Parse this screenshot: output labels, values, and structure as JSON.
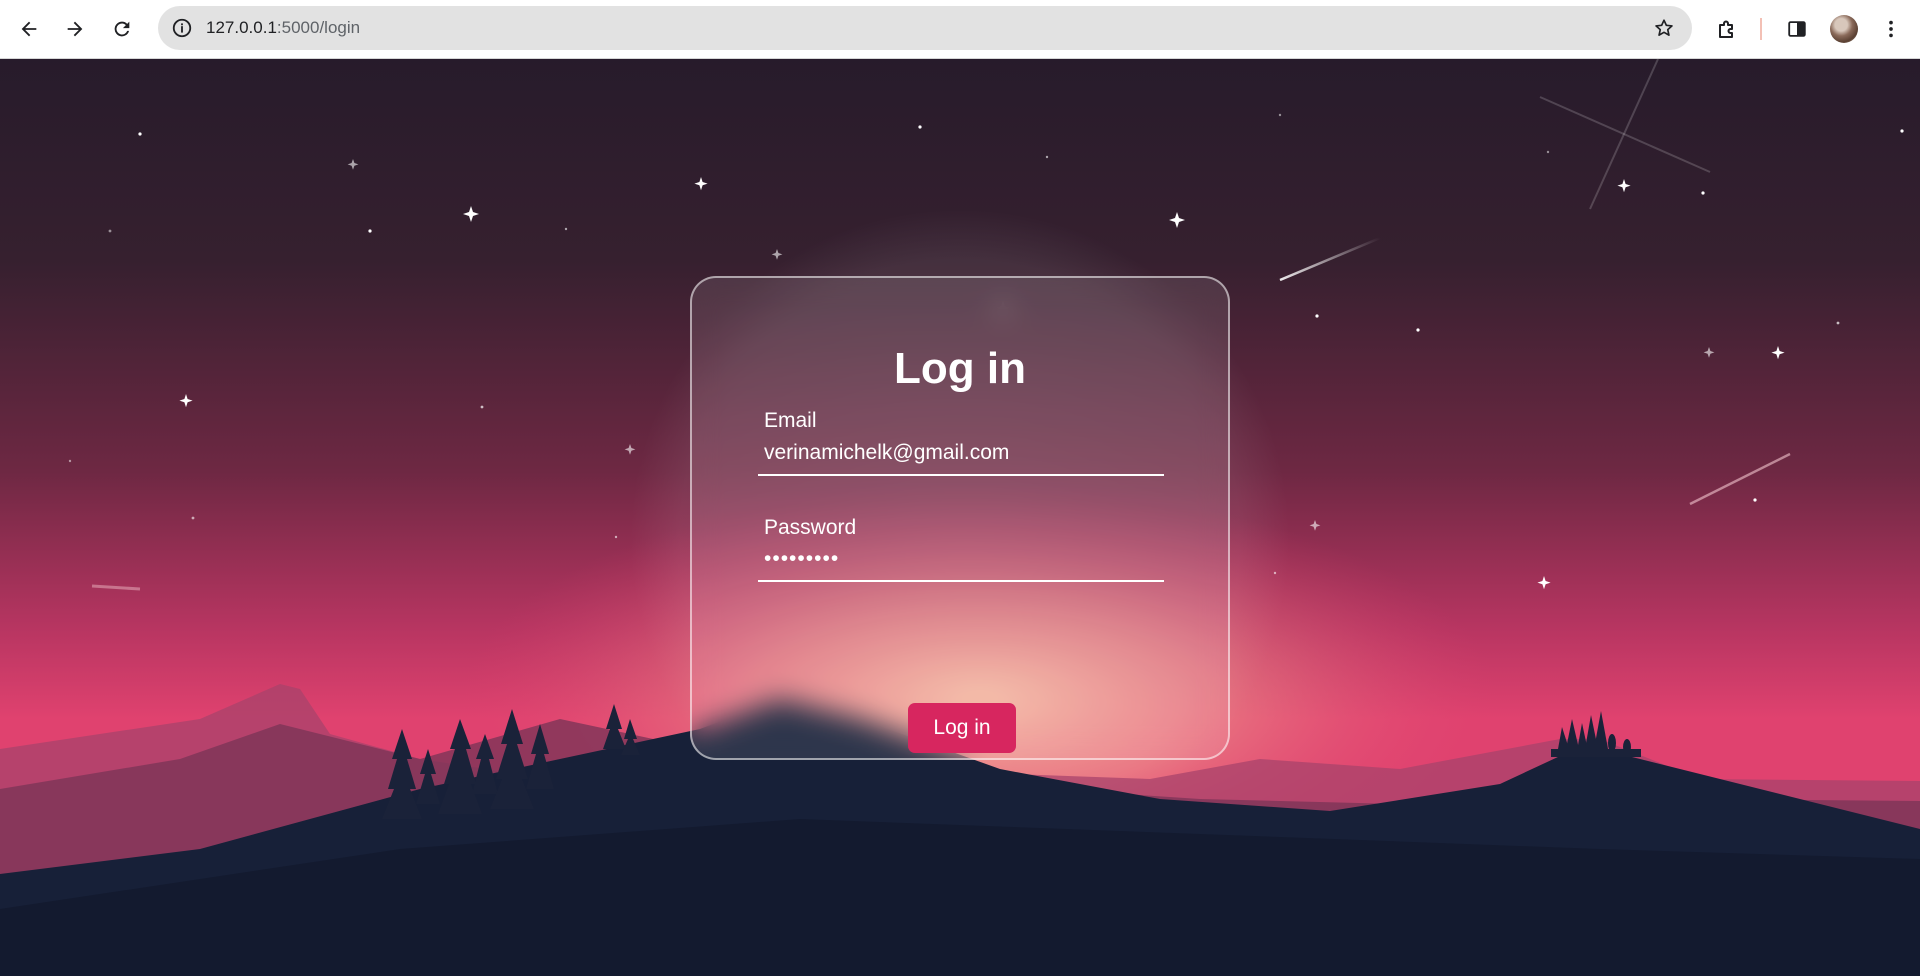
{
  "browser": {
    "url_host": "127.0.0.1",
    "url_path": ":5000/login",
    "icons": {
      "back": "arrow-left-icon",
      "forward": "arrow-right-icon",
      "reload": "reload-icon",
      "site_info": "info-icon",
      "bookmark": "star-icon",
      "extensions": "puzzle-icon",
      "side_panel": "side-panel-icon",
      "menu": "kebab-menu-icon"
    }
  },
  "login": {
    "title": "Log in",
    "email_label": "Email",
    "email_value": "verinamichelk@gmail.com",
    "password_label": "Password",
    "password_value": "•••••••••",
    "submit_label": "Log in"
  },
  "colors": {
    "accent": "#d7265f",
    "sky_top": "#2a1c2c",
    "sky_bottom": "#e0426f",
    "ground": "#141d33"
  }
}
